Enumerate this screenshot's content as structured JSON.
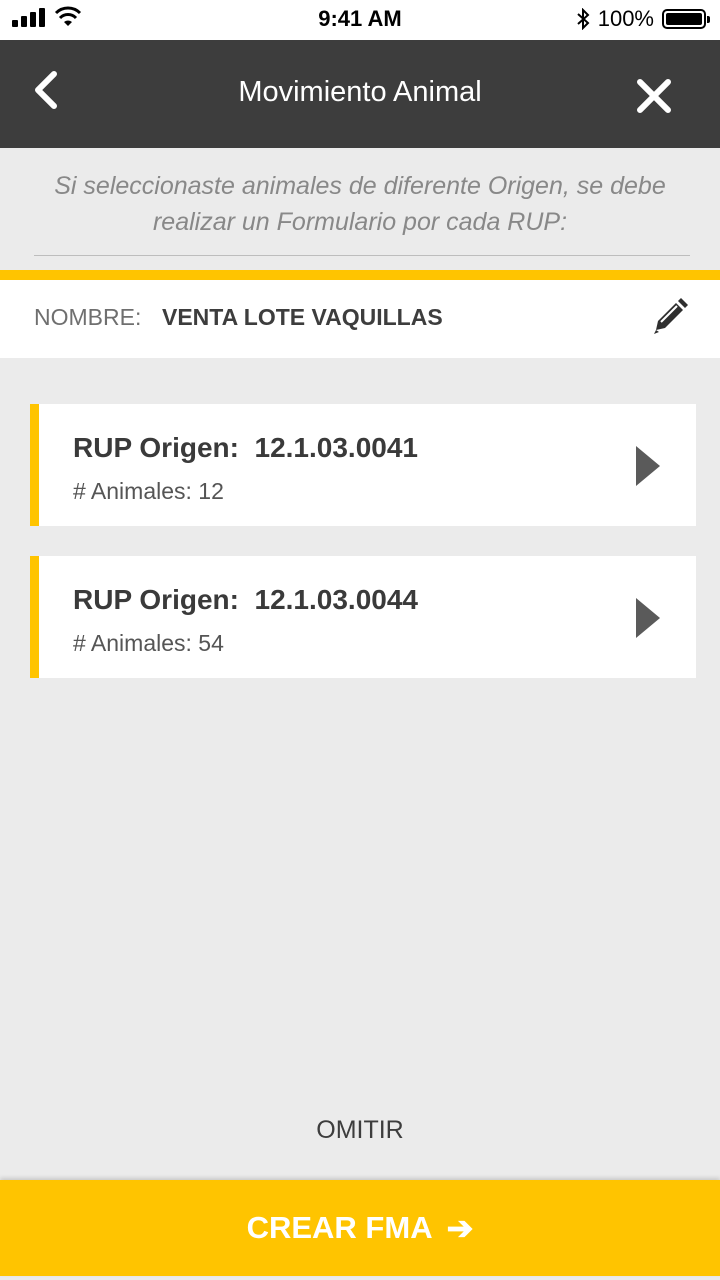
{
  "status_bar": {
    "time": "9:41 AM",
    "battery": "100%",
    "icons": [
      "signal-icon",
      "wifi-icon",
      "bluetooth-icon",
      "battery-icon"
    ]
  },
  "nav": {
    "title": "Movimiento Animal",
    "back_icon": "chevron-left-icon",
    "close_icon": "close-icon"
  },
  "info_text": "Si seleccionaste animales de diferente Origen, se debe realizar un Formulario por cada RUP:",
  "name_row": {
    "label": "NOMBRE:",
    "value": "VENTA LOTE VAQUILLAS",
    "edit_icon": "pencil-icon"
  },
  "cards": [
    {
      "rup_label": "RUP Origen:  12.1.03.0041",
      "count_label": "# Animales: 12"
    },
    {
      "rup_label": "RUP Origen:  12.1.03.0044",
      "count_label": "# Animales: 54"
    }
  ],
  "omit_label": "OMITIR",
  "cta_label": "CREAR FMA",
  "colors": {
    "accent": "#ffc400",
    "nav_bg": "#3d3d3d",
    "page_bg": "#ebebeb"
  }
}
